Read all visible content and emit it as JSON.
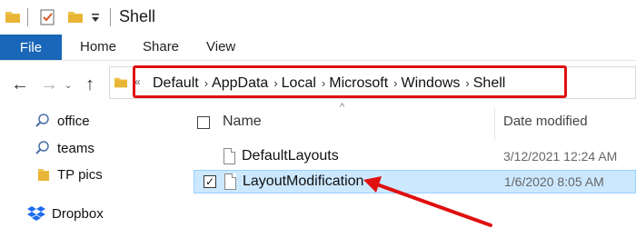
{
  "window": {
    "title": "Shell"
  },
  "ribbon": {
    "tabs": [
      "File",
      "Home",
      "Share",
      "View"
    ]
  },
  "address": {
    "overflow_glyph": "«",
    "crumbs": [
      "Default",
      "AppData",
      "Local",
      "Microsoft",
      "Windows",
      "Shell"
    ],
    "chevron": "›"
  },
  "nav": {
    "back": "←",
    "forward": "→",
    "up": "↑",
    "items": [
      {
        "label": "office",
        "icon": "search-icon"
      },
      {
        "label": "teams",
        "icon": "search-icon"
      },
      {
        "label": "TP pics",
        "icon": "folder-icon"
      },
      {
        "label": "Dropbox",
        "icon": "dropbox-icon"
      }
    ]
  },
  "list": {
    "columns": {
      "name": "Name",
      "date": "Date modified"
    },
    "sort_glyph": "^",
    "rows": [
      {
        "name": "DefaultLayouts",
        "date": "3/12/2021 12:24 AM",
        "selected": false,
        "checked": false
      },
      {
        "name": "LayoutModification",
        "date": "1/6/2020 8:05 AM",
        "selected": true,
        "checked": true
      }
    ],
    "check_glyph": "✓"
  },
  "colors": {
    "accent": "#1a66b8",
    "highlight": "#e01010",
    "selection": "#cce8ff",
    "folder": "#f0c34d"
  }
}
